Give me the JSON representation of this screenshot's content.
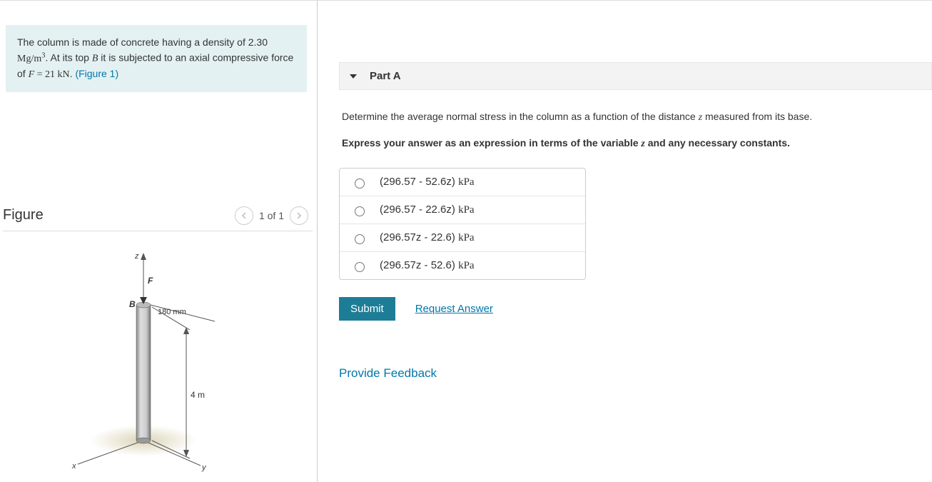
{
  "problem": {
    "text_pre": "The column is made of concrete having a density of 2.30 ",
    "unit_density": "Mg/m",
    "unit_density_sup": "3",
    "text_mid": ". At its top ",
    "var_B": "B",
    "text_mid2": " it is subjected to an axial compressive force of ",
    "var_F": "F",
    "eq": " = 21 kN",
    "text_end": ". ",
    "figure_link": "(Figure 1)"
  },
  "figure": {
    "title": "Figure",
    "pager_text": "1 of 1",
    "labels": {
      "z": "z",
      "F": "F",
      "B": "B",
      "diameter": "180 mm",
      "height": "4 m",
      "x": "x",
      "y": "y"
    }
  },
  "part": {
    "title": "Part A",
    "instruction1_a": "Determine the average normal stress in the column as a function of the distance ",
    "instruction1_var": "z",
    "instruction1_b": " measured from its base.",
    "instruction2_a": "Express your answer as an expression in terms of the variable ",
    "instruction2_var": "z",
    "instruction2_b": " and any necessary constants."
  },
  "options": [
    {
      "expr": "(296.57 - 52.6z) ",
      "unit": "kPa"
    },
    {
      "expr": "(296.57 - 22.6z) ",
      "unit": "kPa"
    },
    {
      "expr": "(296.57z - 22.6) ",
      "unit": "kPa"
    },
    {
      "expr": "(296.57z - 52.6) ",
      "unit": "kPa"
    }
  ],
  "actions": {
    "submit": "Submit",
    "request": "Request Answer",
    "feedback": "Provide Feedback"
  }
}
